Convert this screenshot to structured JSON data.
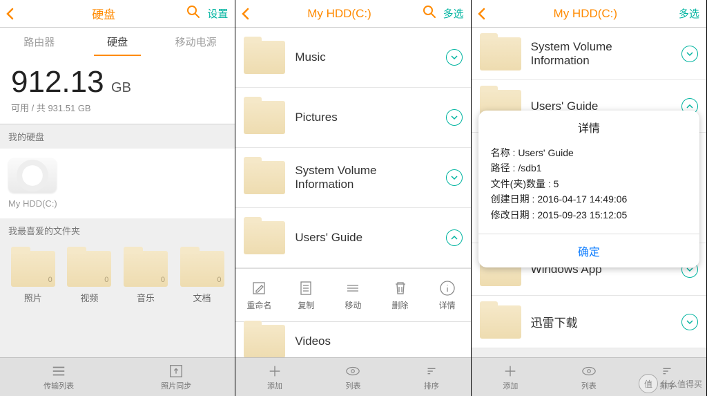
{
  "p1": {
    "title": "硬盘",
    "hdr_right": "设置",
    "tabs": [
      "路由器",
      "硬盘",
      "移动电源"
    ],
    "capacity_value": "912.13",
    "capacity_unit": "GB",
    "capacity_sub": "可用 / 共 931.51 GB",
    "my_drive_section": "我的硬盘",
    "drive_label": "My HDD(C:)",
    "fav_section": "我最喜爱的文件夹",
    "favs": [
      {
        "label": "照片",
        "count": "0"
      },
      {
        "label": "视频",
        "count": "0"
      },
      {
        "label": "音乐",
        "count": "0"
      },
      {
        "label": "文档",
        "count": "0"
      }
    ],
    "bottom": [
      {
        "label": "传输列表"
      },
      {
        "label": "照片同步"
      }
    ]
  },
  "p2": {
    "title": "My HDD(C:)",
    "hdr_right": "多选",
    "files": [
      {
        "name": "Music",
        "chev": "down"
      },
      {
        "name": "Pictures",
        "chev": "down"
      },
      {
        "name": "System Volume Information",
        "chev": "down"
      },
      {
        "name": "Users' Guide",
        "chev": "up"
      },
      {
        "name": "Videos",
        "chev": "down"
      }
    ],
    "actions": [
      "重命名",
      "复制",
      "移动",
      "删除",
      "详情"
    ],
    "bottom": [
      "添加",
      "列表",
      "排序"
    ]
  },
  "p3": {
    "title": "My HDD(C:)",
    "hdr_right": "多选",
    "files": [
      {
        "name": "System Volume Information",
        "chev": "down"
      },
      {
        "name": "Users' Guide",
        "chev": "up"
      },
      {
        "name": "Windows App",
        "chev": "down"
      },
      {
        "name": "迅雷下载",
        "chev": "down"
      }
    ],
    "dialog": {
      "title": "详情",
      "lines": [
        "名称 : Users' Guide",
        "路径 : /sdb1",
        "文件(夹)数量 : 5",
        "创建日期 : 2016-04-17 14:49:06",
        "修改日期 : 2015-09-23 15:12:05"
      ],
      "ok": "确定"
    },
    "bottom": [
      "添加",
      "列表",
      "排序"
    ]
  },
  "watermark": "什么值得买"
}
